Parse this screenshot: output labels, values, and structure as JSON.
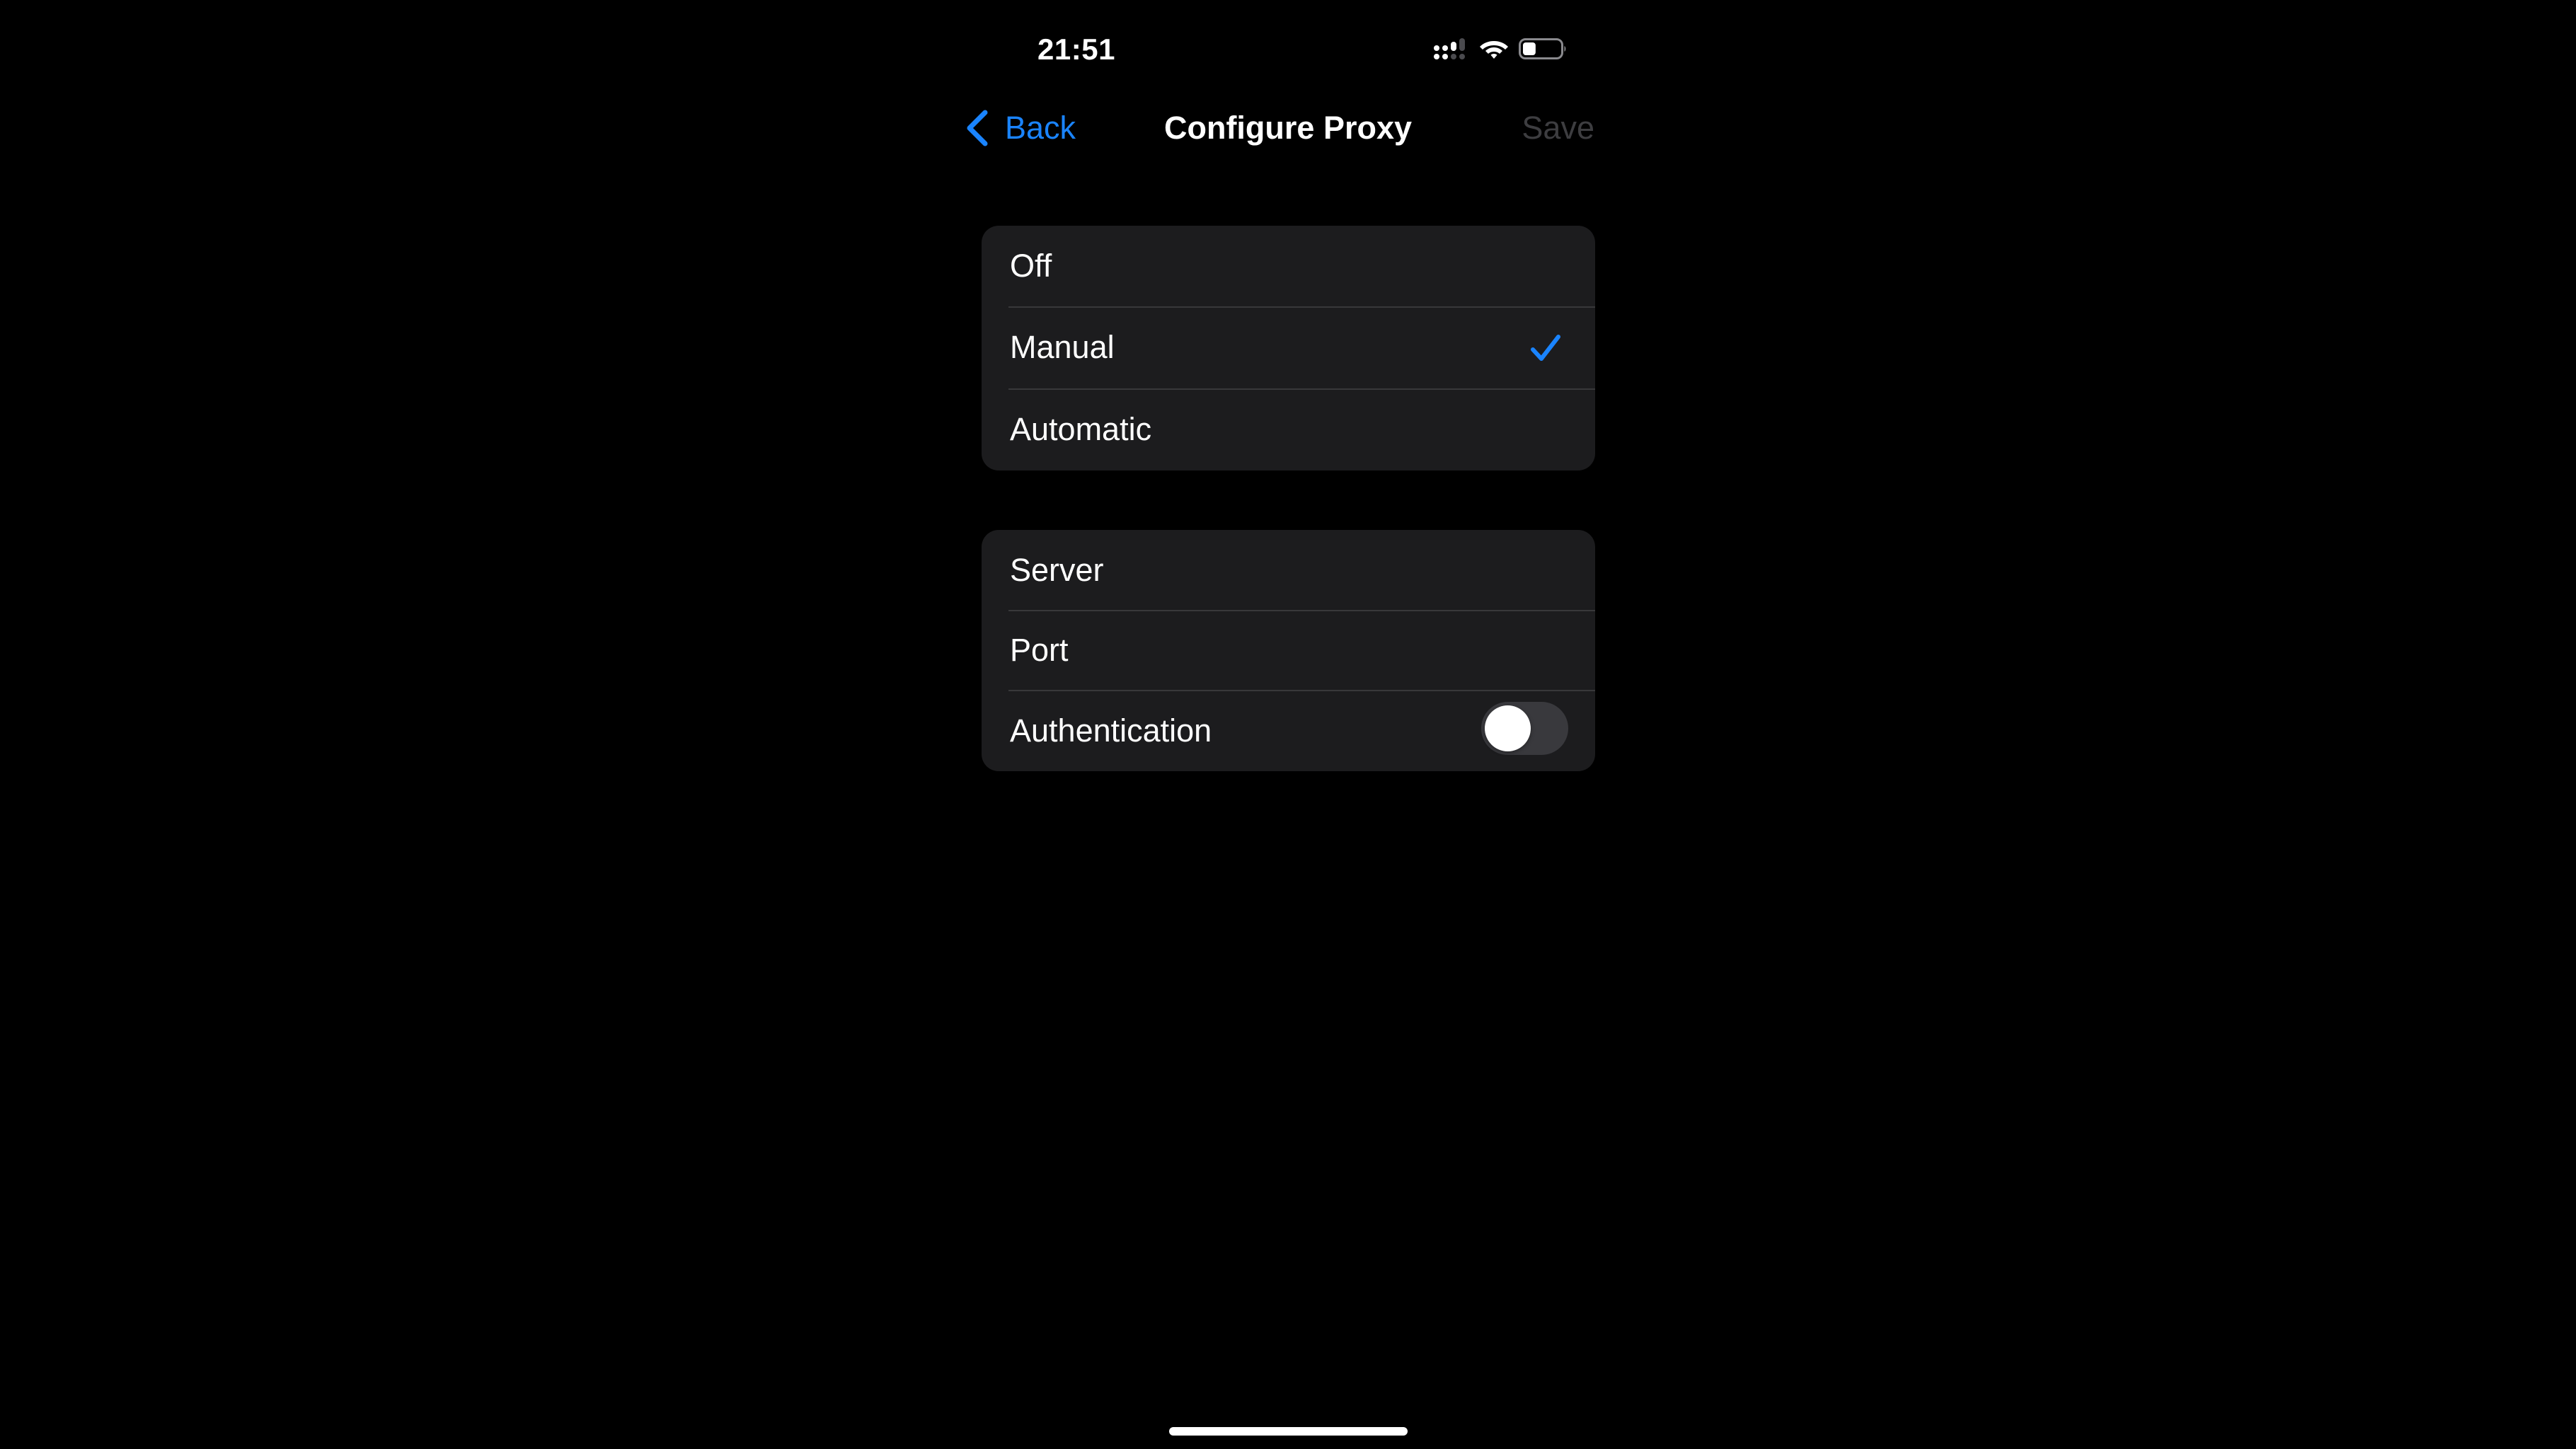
{
  "theme": {
    "accent": "#1a84ff",
    "background": "#000000",
    "group_background": "#1c1c1e",
    "separator": "#38383a",
    "disabled_text": "#3d3d40"
  },
  "status_bar": {
    "time": "21:51",
    "icons": {
      "cellular": "cellular-signal-icon",
      "wifi": "wifi-icon",
      "battery": "battery-icon"
    },
    "cellular_primary_bars": 3,
    "cellular_secondary_bars": 2,
    "cellular_max_bars": 4,
    "battery_level_percent": 35
  },
  "nav": {
    "back_label": "Back",
    "back_icon": "chevron-left-icon",
    "title": "Configure Proxy",
    "save_label": "Save",
    "save_enabled": false
  },
  "proxy_modes": {
    "selected": "Manual",
    "options": [
      {
        "label": "Off",
        "selected": false
      },
      {
        "label": "Manual",
        "selected": true
      },
      {
        "label": "Automatic",
        "selected": false
      }
    ]
  },
  "manual_settings": {
    "server": {
      "label": "Server",
      "value": "",
      "placeholder": ""
    },
    "port": {
      "label": "Port",
      "value": "",
      "placeholder": ""
    },
    "authentication": {
      "label": "Authentication",
      "enabled": false
    }
  }
}
